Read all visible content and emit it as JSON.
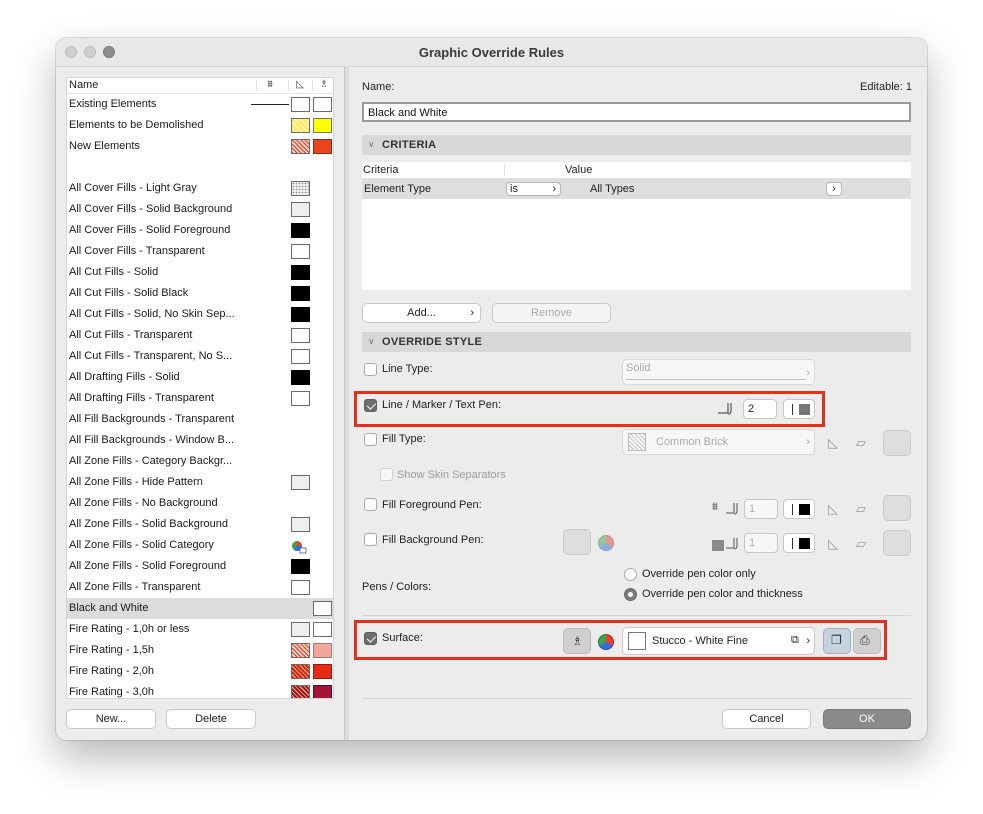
{
  "window": {
    "title": "Graphic Override Rules"
  },
  "left": {
    "header": {
      "name_col": "Name"
    },
    "rules": [
      {
        "label": "Existing Elements"
      },
      {
        "label": "Elements to be Demolished"
      },
      {
        "label": "New Elements"
      },
      {
        "label": "All Cover Fills - Light Gray"
      },
      {
        "label": "All Cover Fills - Solid Background"
      },
      {
        "label": "All Cover Fills - Solid Foreground"
      },
      {
        "label": "All Cover Fills - Transparent"
      },
      {
        "label": "All Cut Fills - Solid"
      },
      {
        "label": "All Cut Fills - Solid Black"
      },
      {
        "label": "All Cut Fills - Solid, No Skin Sep..."
      },
      {
        "label": "All Cut Fills - Transparent"
      },
      {
        "label": "All Cut Fills - Transparent, No S..."
      },
      {
        "label": "All Drafting Fills - Solid"
      },
      {
        "label": "All Drafting Fills - Transparent"
      },
      {
        "label": "All Fill Backgrounds - Transparent"
      },
      {
        "label": "All Fill Backgrounds - Window B..."
      },
      {
        "label": "All Zone Fills - Category Backgr..."
      },
      {
        "label": "All Zone Fills - Hide Pattern"
      },
      {
        "label": "All Zone Fills - No Background"
      },
      {
        "label": "All Zone Fills - Solid Background"
      },
      {
        "label": "All Zone Fills - Solid Category"
      },
      {
        "label": "All Zone Fills - Solid Foreground"
      },
      {
        "label": "All Zone Fills - Transparent"
      },
      {
        "label": "Black and White"
      },
      {
        "label": "Fire Rating - 1,0h or less"
      },
      {
        "label": "Fire Rating - 1,5h"
      },
      {
        "label": "Fire Rating - 2,0h"
      },
      {
        "label": "Fire Rating - 3,0h"
      }
    ],
    "selected_rule": "Black and White",
    "new_button": "New...",
    "delete_button": "Delete"
  },
  "right": {
    "name_label": "Name:",
    "editable_text": "Editable: 1",
    "name_value": "Black and White",
    "criteria": {
      "section_title": "CRITERIA",
      "col_criteria": "Criteria",
      "col_value": "Value",
      "row": {
        "criteria": "Element Type",
        "operator": "is",
        "value": "All Types"
      },
      "add_button": "Add...",
      "remove_button": "Remove"
    },
    "override": {
      "section_title": "OVERRIDE STYLE",
      "line_type_label": "Line Type:",
      "line_type_value": "Solid",
      "pen_label": "Line / Marker / Text Pen:",
      "pen_value": "2",
      "fill_type_label": "Fill Type:",
      "fill_type_value": "Common Brick",
      "skin_label": "Show Skin Separators",
      "fg_pen_label": "Fill Foreground Pen:",
      "fg_pen_value": "1",
      "bg_pen_label": "Fill Background Pen:",
      "bg_pen_value": "1",
      "pens_colors_label": "Pens / Colors:",
      "radio_color_only": "Override pen color only",
      "radio_color_thickness": "Override pen color and thickness",
      "surface_label": "Surface:",
      "surface_value": "Stucco - White Fine"
    },
    "cancel_button": "Cancel",
    "ok_button": "OK"
  },
  "colors": {
    "highlight": "#e0321c",
    "selection": "#dcdcdc"
  }
}
